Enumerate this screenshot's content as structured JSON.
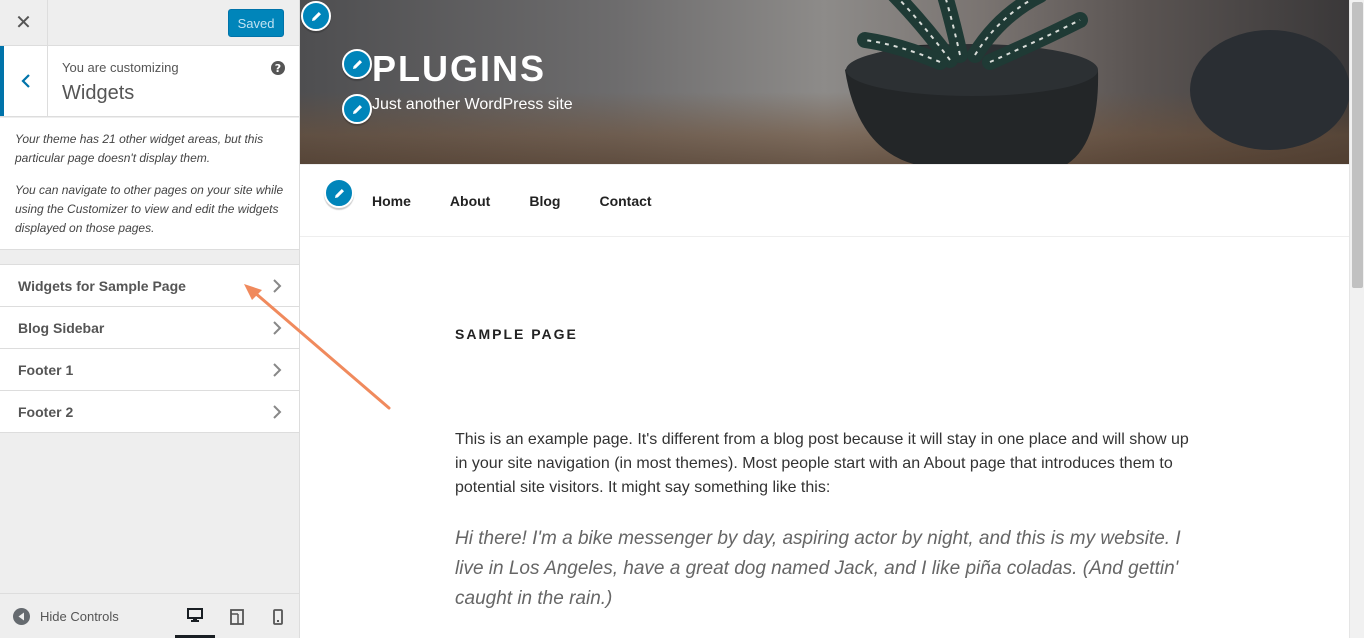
{
  "sidebar": {
    "close_label": "✕",
    "save_label": "Saved",
    "customizing_label": "You are customizing",
    "panel_title": "Widgets",
    "help_label": "?",
    "notice_p1": "Your theme has 21 other widget areas, but this particular page doesn't display them.",
    "notice_p2": "You can navigate to other pages on your site while using the Customizer to view and edit the widgets displayed on those pages.",
    "sections": [
      {
        "label": "Widgets for Sample Page"
      },
      {
        "label": "Blog Sidebar"
      },
      {
        "label": "Footer 1"
      },
      {
        "label": "Footer 2"
      }
    ],
    "hide_controls_label": "Hide Controls",
    "devices": [
      "desktop-icon",
      "tablet-icon",
      "mobile-icon"
    ],
    "active_device": "desktop"
  },
  "preview": {
    "site_title": "PLUGINS",
    "site_tagline": "Just another WordPress site",
    "nav": [
      "Home",
      "About",
      "Blog",
      "Contact"
    ],
    "page_heading": "SAMPLE PAGE",
    "body_text": "This is an example page. It's different from a blog post because it will stay in one place and will show up in your site navigation (in most themes). Most people start with an About page that introduces them to potential site visitors. It might say something like this:",
    "quote_text": "Hi there! I'm a bike messenger by day, aspiring actor by night, and this is my website. I live in Los Angeles, have a great dog named Jack, and I like piña coladas. (And gettin' caught in the rain.)"
  },
  "colors": {
    "accent": "#0073aa",
    "button": "#0085ba",
    "annotation_arrow": "#f08a5d"
  }
}
